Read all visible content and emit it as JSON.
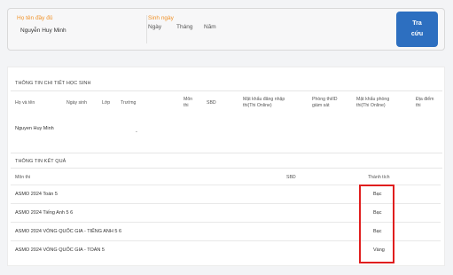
{
  "search": {
    "fullname_label": "Họ tên đầy đủ",
    "fullname_value": "Nguyễn Huy Minh",
    "dob_label": "Sinh ngày",
    "day_label": "Ngày",
    "month_label": "Tháng",
    "year_label": "Năm",
    "button_line1": "Tra",
    "button_line2": "cứu"
  },
  "student_info": {
    "title": "THÔNG TIN CHI TIẾT HỌC SINH",
    "columns": {
      "name": "Họ và tên",
      "dob": "Ngày sinh",
      "class": "Lớp",
      "school": "Trường",
      "subject_1": "Môn",
      "subject_2": "thi",
      "sbd": "SBD",
      "password_1": "Mật khẩu đăng nhập",
      "password_2": "thi(Thi Online)",
      "room_1": "Phòng thi/ID",
      "room_2": "giám sát",
      "room_pw_1": "Mật khẩu phòng",
      "room_pw_2": "thi(Thi Online)",
      "location_1": "Địa điểm",
      "location_2": "thi"
    },
    "row": {
      "name": "Nguyen Huy Minh",
      "school": "-"
    }
  },
  "results": {
    "title": "THÔNG TIN KẾT QUẢ",
    "col_subject": "Môn thi",
    "col_sbd": "SBD",
    "col_award": "Thành tích",
    "rows": [
      {
        "subject": "ASMO 2024 Toán 5",
        "award": "Bạc"
      },
      {
        "subject": "ASMO 2024 Tiếng Anh 5 6",
        "award": "Bạc"
      },
      {
        "subject": "ASMO 2024 VÒNG QUỐC GIA - TIẾNG ANH 5 6",
        "award": "Bạc"
      },
      {
        "subject": "ASMO 2024 VÒNG QUỐC GIA - TOÁN 5",
        "award": "Vàng"
      }
    ]
  },
  "colors": {
    "accent_label": "#f0932b",
    "button": "#2d6fc0",
    "highlight": "#e01e1e"
  }
}
